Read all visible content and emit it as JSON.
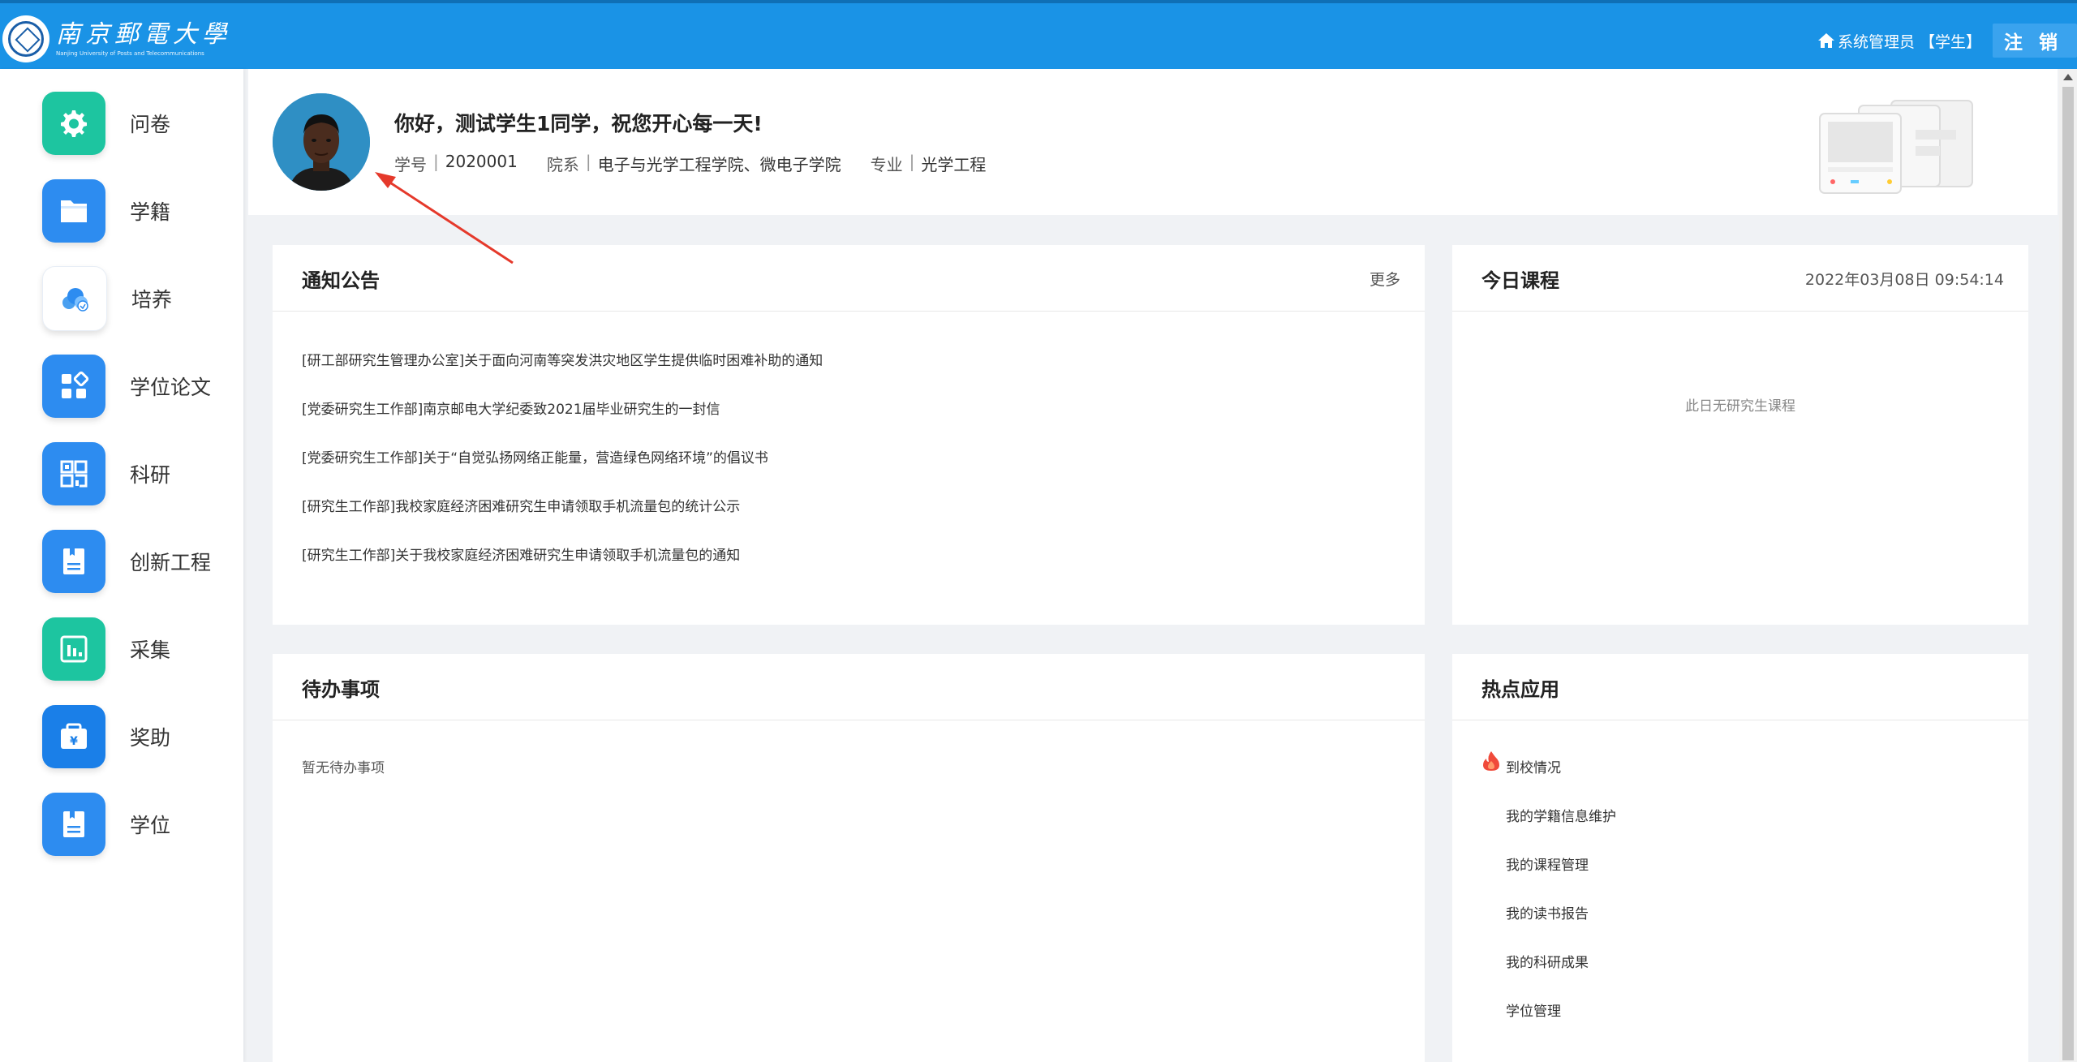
{
  "header": {
    "logo_text": "南京郵電大學",
    "logo_subtitle": "Nanjing University of Posts and Telecommunications",
    "user_role": "系统管理员",
    "user_identity": "【学生】",
    "logout_label": "注 销",
    "bg_color": "#1a93e6"
  },
  "sidebar": {
    "items": [
      {
        "label": "问卷",
        "icon": "gear-icon",
        "color": "#1dc5a0"
      },
      {
        "label": "学籍",
        "icon": "folder-icon",
        "color": "#2d8cf0"
      },
      {
        "label": "培养",
        "icon": "cloud-icon",
        "color": "#ffffff"
      },
      {
        "label": "学位论文",
        "icon": "apps-icon",
        "color": "#2d8cf0"
      },
      {
        "label": "科研",
        "icon": "qrcode-icon",
        "color": "#2d8cf0"
      },
      {
        "label": "创新工程",
        "icon": "bookmark-doc-icon",
        "color": "#2d8cf0"
      },
      {
        "label": "采集",
        "icon": "bar-chart-icon",
        "color": "#1dc5a0"
      },
      {
        "label": "奖助",
        "icon": "yen-wallet-icon",
        "color": "#1a7fe8"
      },
      {
        "label": "学位",
        "icon": "bookmark-doc-icon",
        "color": "#2d8cf0"
      }
    ]
  },
  "profile": {
    "greeting": "你好，测试学生1同学，祝您开心每一天!",
    "student_id_label": "学号",
    "student_id": "2020001",
    "department_label": "院系",
    "department": "电子与光学工程学院、微电子学院",
    "major_label": "专业",
    "major": "光学工程"
  },
  "notices": {
    "title": "通知公告",
    "more_label": "更多",
    "items": [
      "[研工部研究生管理办公室]关于面向河南等突发洪灾地区学生提供临时困难补助的通知",
      "[党委研究生工作部]南京邮电大学纪委致2021届毕业研究生的一封信",
      "[党委研究生工作部]关于“自觉弘扬网络正能量，营造绿色网络环境”的倡议书",
      "[研究生工作部]我校家庭经济困难研究生申请领取手机流量包的统计公示",
      "[研究生工作部]关于我校家庭经济困难研究生申请领取手机流量包的通知"
    ]
  },
  "courses": {
    "title": "今日课程",
    "datetime": "2022年03月08日 09:54:14",
    "empty_text": "此日无研究生课程"
  },
  "todo": {
    "title": "待办事项",
    "empty_text": "暂无待办事项"
  },
  "hot_apps": {
    "title": "热点应用",
    "items": [
      "到校情况",
      "我的学籍信息维护",
      "我的课程管理",
      "我的读书报告",
      "我的科研成果",
      "学位管理"
    ]
  }
}
